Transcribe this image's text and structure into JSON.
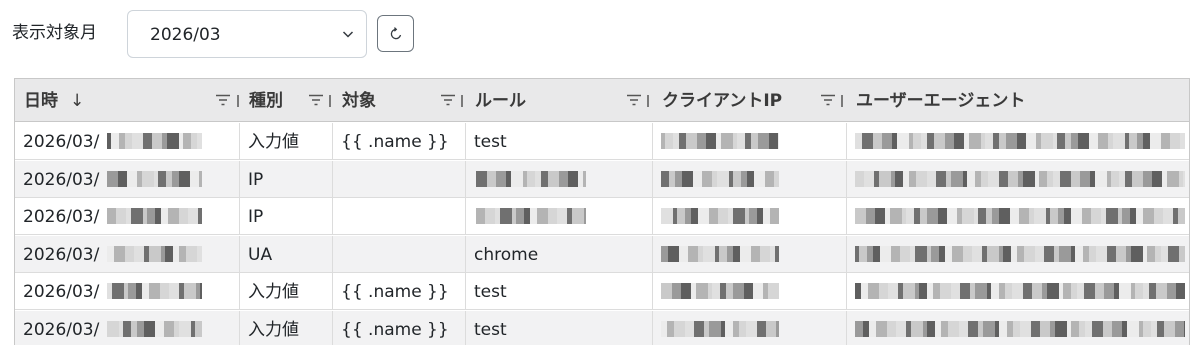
{
  "filter": {
    "label": "表示対象月",
    "month_value": "2026/03",
    "refresh_icon": "refresh-icon",
    "dropdown_icon": "chevron-down-icon"
  },
  "table": {
    "columns": [
      {
        "label": "日時",
        "sort": "↓"
      },
      {
        "label": "種別"
      },
      {
        "label": "対象"
      },
      {
        "label": "ルール"
      },
      {
        "label": "クライアントIP"
      },
      {
        "label": "ユーザーエージェント"
      }
    ],
    "rows": [
      {
        "datetime": "2026/03/",
        "type": "入力値",
        "target": "{{ .name }}",
        "rule": "test"
      },
      {
        "datetime": "2026/03/",
        "type": "IP",
        "target": "",
        "rule": ""
      },
      {
        "datetime": "2026/03/",
        "type": "IP",
        "target": "",
        "rule": ""
      },
      {
        "datetime": "2026/03/",
        "type": "UA",
        "target": "",
        "rule": "chrome"
      },
      {
        "datetime": "2026/03/",
        "type": "入力値",
        "target": "{{ .name }}",
        "rule": "test"
      },
      {
        "datetime": "2026/03/",
        "type": "入力値",
        "target": "{{ .name }}",
        "rule": "test"
      }
    ]
  }
}
